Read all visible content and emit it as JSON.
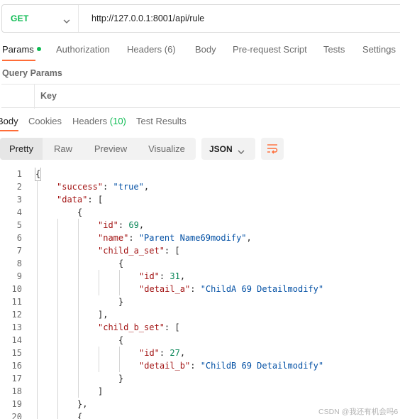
{
  "request": {
    "method": "GET",
    "url": "http://127.0.0.1:8001/api/rule"
  },
  "request_tabs": {
    "params": "Params",
    "authorization": "Authorization",
    "headers": "Headers",
    "headers_count": "(6)",
    "body": "Body",
    "prerequest": "Pre-request Script",
    "tests": "Tests",
    "settings": "Settings"
  },
  "query_params": {
    "title": "Query Params",
    "key_header": "Key"
  },
  "response_tabs": {
    "body": "Body",
    "cookies": "Cookies",
    "headers": "Headers",
    "headers_count": "(10)",
    "test_results": "Test Results"
  },
  "view_modes": {
    "pretty": "Pretty",
    "raw": "Raw",
    "preview": "Preview",
    "visualize": "Visualize"
  },
  "format": "JSON",
  "line_numbers": [
    "1",
    "2",
    "3",
    "4",
    "5",
    "6",
    "7",
    "8",
    "9",
    "10",
    "11",
    "12",
    "13",
    "14",
    "15",
    "16",
    "17",
    "18",
    "19",
    "20"
  ],
  "code": {
    "l1": "{",
    "l2_key": "\"success\"",
    "l2_val": "\"true\"",
    "l3_key": "\"data\"",
    "l3_rest": "[",
    "l4": "{",
    "l5_key": "\"id\"",
    "l5_val": "69",
    "l6_key": "\"name\"",
    "l6_val": "\"Parent Name69modify\"",
    "l7_key": "\"child_a_set\"",
    "l7_rest": "[",
    "l8": "{",
    "l9_key": "\"id\"",
    "l9_val": "31",
    "l10_key": "\"detail_a\"",
    "l10_val": "\"ChildA 69 Detailmodify\"",
    "l11": "}",
    "l12": "],",
    "l13_key": "\"child_b_set\"",
    "l13_rest": "[",
    "l14": "{",
    "l15_key": "\"id\"",
    "l15_val": "27",
    "l16_key": "\"detail_b\"",
    "l16_val": "\"ChildB 69 Detailmodify\"",
    "l17": "}",
    "l18": "]",
    "l19": "},",
    "l20": "{"
  },
  "watermark": "CSDN @我还有机会吗6",
  "colors": {
    "accent": "#ff6c37",
    "method_get": "#0cbb52",
    "json_key": "#a31515",
    "json_string": "#0451a5",
    "json_number": "#098658"
  }
}
